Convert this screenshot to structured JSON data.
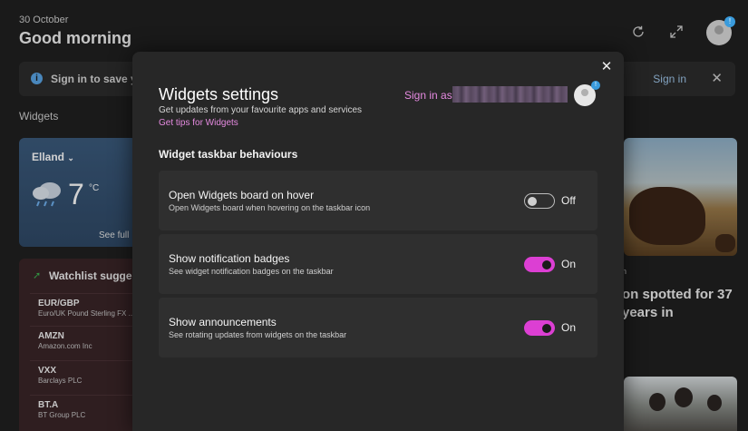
{
  "board": {
    "date": "30 October",
    "greeting": "Good morning",
    "signin_bar": {
      "text": "Sign in to save yo",
      "sign_in_label": "Sign in"
    },
    "widgets_label": "Widgets",
    "weather": {
      "city": "Elland",
      "temperature": "7",
      "unit": "°C",
      "see_full": "See full"
    },
    "watchlist": {
      "title": "Watchlist suggest",
      "items": [
        {
          "symbol": "EUR/GBP",
          "name": "Euro/UK Pound Sterling FX ..."
        },
        {
          "symbol": "AMZN",
          "name": "Amazon.com Inc"
        },
        {
          "symbol": "VXX",
          "name": "Barclays PLC"
        },
        {
          "symbol": "BT.A",
          "name": "BT Group PLC"
        }
      ]
    },
    "news": {
      "tag": "n",
      "headline": "on spotted for 37 years in"
    }
  },
  "modal": {
    "title": "Widgets settings",
    "subtitle": "Get updates from your favourite apps and services",
    "tips_link": "Get tips for Widgets",
    "signin_as": "Sign in as",
    "avatar_badge": "!",
    "section_title": "Widget taskbar behaviours",
    "settings": [
      {
        "name": "Open Widgets board on hover",
        "description": "Open Widgets board when hovering on the taskbar icon",
        "state": "Off"
      },
      {
        "name": "Show notification badges",
        "description": "See widget notification badges on the taskbar",
        "state": "On"
      },
      {
        "name": "Show announcements",
        "description": "See rotating updates from widgets on the taskbar",
        "state": "On"
      }
    ]
  },
  "colors": {
    "accent": "#dc3fd3",
    "link": "#e58ae0",
    "modal_bg": "#272727",
    "card_bg": "#2f2f2f"
  },
  "icons": [
    "refresh-icon",
    "expand-icon",
    "avatar",
    "close-icon",
    "info-icon",
    "chevron-down-icon",
    "weather-icon",
    "trend-up-icon"
  ]
}
